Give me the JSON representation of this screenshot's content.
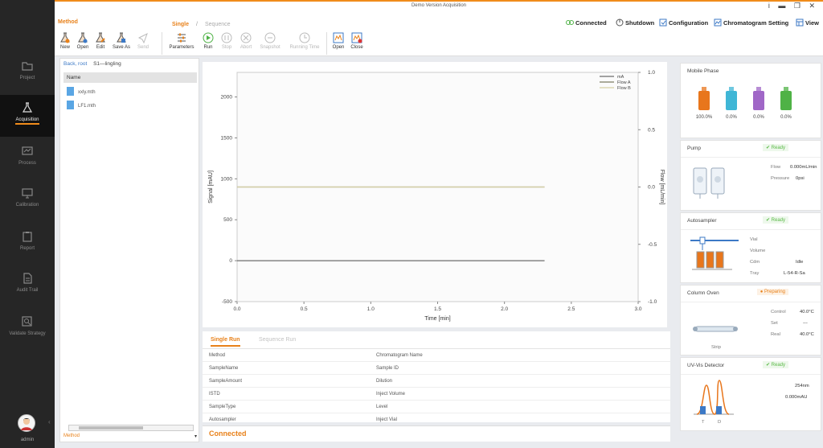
{
  "window": {
    "title": "Demo Version Acquisition",
    "controls": "i ▬ ❐ ✕"
  },
  "nav": {
    "items": [
      {
        "label": "Project"
      },
      {
        "label": "Acquisition"
      },
      {
        "label": "Process"
      },
      {
        "label": "Calibration"
      },
      {
        "label": "Report"
      },
      {
        "label": "Audit Trail"
      },
      {
        "label": "Validate Strategy"
      }
    ],
    "user": "admin",
    "collapse": "‹"
  },
  "toolbar": {
    "method_label": "Method",
    "mode_single": "Single",
    "mode_sep": "/",
    "mode_sequence": "Sequence",
    "new": "New",
    "open": "Open",
    "edit": "Edit",
    "save_as": "Save As",
    "send": "Send",
    "parameters": "Parameters",
    "run": "Run",
    "stop": "Stop",
    "abort": "Abort",
    "snapshot": "Snapshot",
    "running_time": "Running Time",
    "file_open": "Open",
    "file_close": "Close"
  },
  "top_right": {
    "connected": "Connected",
    "shutdown": "Shutdown",
    "configuration": "Configuration",
    "chromatogram_setting": "Chromatogram Setting",
    "view": "View"
  },
  "files": {
    "breadcrumb_back": "Back, root",
    "breadcrumb_current": "S1—lingling",
    "name_header": "Name",
    "items": [
      "xxly.mth",
      "LF1.mth"
    ],
    "bottom_label": "Method",
    "bottom_select": "▾"
  },
  "chart_data": {
    "type": "line",
    "xlabel": "Time [min]",
    "ylabel": "Signal [mAU]",
    "y2label": "Flow [mL/min]",
    "xlim": [
      0,
      3.0
    ],
    "ylim": [
      -500,
      2300
    ],
    "y2lim": [
      -1.0,
      1.0
    ],
    "x_ticks": [
      "0.0",
      "0.5",
      "1.0",
      "1.5",
      "2.0",
      "2.5",
      "3.0"
    ],
    "y_ticks": [
      "-500",
      "0",
      "500",
      "1000",
      "1500",
      "2000"
    ],
    "y2_ticks": [
      "-1.0",
      "-0.5",
      "0.0",
      "0.5",
      "1.0"
    ],
    "legend_position": "top-right",
    "series": [
      {
        "name": "mA",
        "color": "#6d6d6d",
        "axis": "left",
        "x": [
          0,
          2.3
        ],
        "y": [
          0,
          0
        ]
      },
      {
        "name": "Flow A",
        "color": "#7b7b62",
        "axis": "right",
        "x": [
          0,
          2.3
        ],
        "y": [
          0,
          0
        ]
      },
      {
        "name": "Flow B",
        "color": "#d6cfa4",
        "axis": "right",
        "x": [
          0,
          2.3
        ],
        "y": [
          0,
          0
        ]
      }
    ]
  },
  "run": {
    "tab_single": "Single Run",
    "tab_sequence": "Sequence Run",
    "rows": [
      {
        "left": "Method",
        "right": "Chromatogram Name"
      },
      {
        "left": "SampleName",
        "right": "Sample ID"
      },
      {
        "left": "SampleAmount",
        "right": "Dilution"
      },
      {
        "left": "ISTD",
        "right": "Inject Volume"
      },
      {
        "left": "SampleType",
        "right": "Level"
      },
      {
        "left": "Autosampler",
        "right": "Inject Vial"
      }
    ]
  },
  "status": {
    "text": "Connected"
  },
  "right": {
    "mobile_phase": {
      "title": "Mobile Phase",
      "bottles": [
        {
          "value": "100.0%",
          "color": "#e8761c"
        },
        {
          "value": "0.0%",
          "color": "#3fb6d6"
        },
        {
          "value": "0.0%",
          "color": "#a067c7"
        },
        {
          "value": "0.0%",
          "color": "#4fb246"
        }
      ]
    },
    "pump": {
      "title": "Pump",
      "status": "Ready",
      "flow_label": "Flow",
      "flow_value": "0.000mL/min",
      "pressure_label": "Pressure",
      "pressure_value": "0psi"
    },
    "autosampler": {
      "title": "Autosampler",
      "status": "Ready",
      "vial_label": "Vial",
      "volume_label": "Volume",
      "cdm_label": "Cdm",
      "cdm_value": "Idle",
      "tray_label": "Tray",
      "tray_value": "L-54-R-Sa"
    },
    "column_oven": {
      "title": "Column Oven",
      "status": "Preparing",
      "image_label": "Strip",
      "control_label": "Control",
      "control_value": "40.0°C",
      "set_label": "Set",
      "set_value": "---",
      "real_label": "Real",
      "real_value": "40.0°C"
    },
    "detector": {
      "title": "UV-Vis Detector",
      "status": "Ready",
      "wavelength": "254nm",
      "absorbance": "0.000mAU",
      "lamp1": "T",
      "lamp2": "D"
    }
  }
}
